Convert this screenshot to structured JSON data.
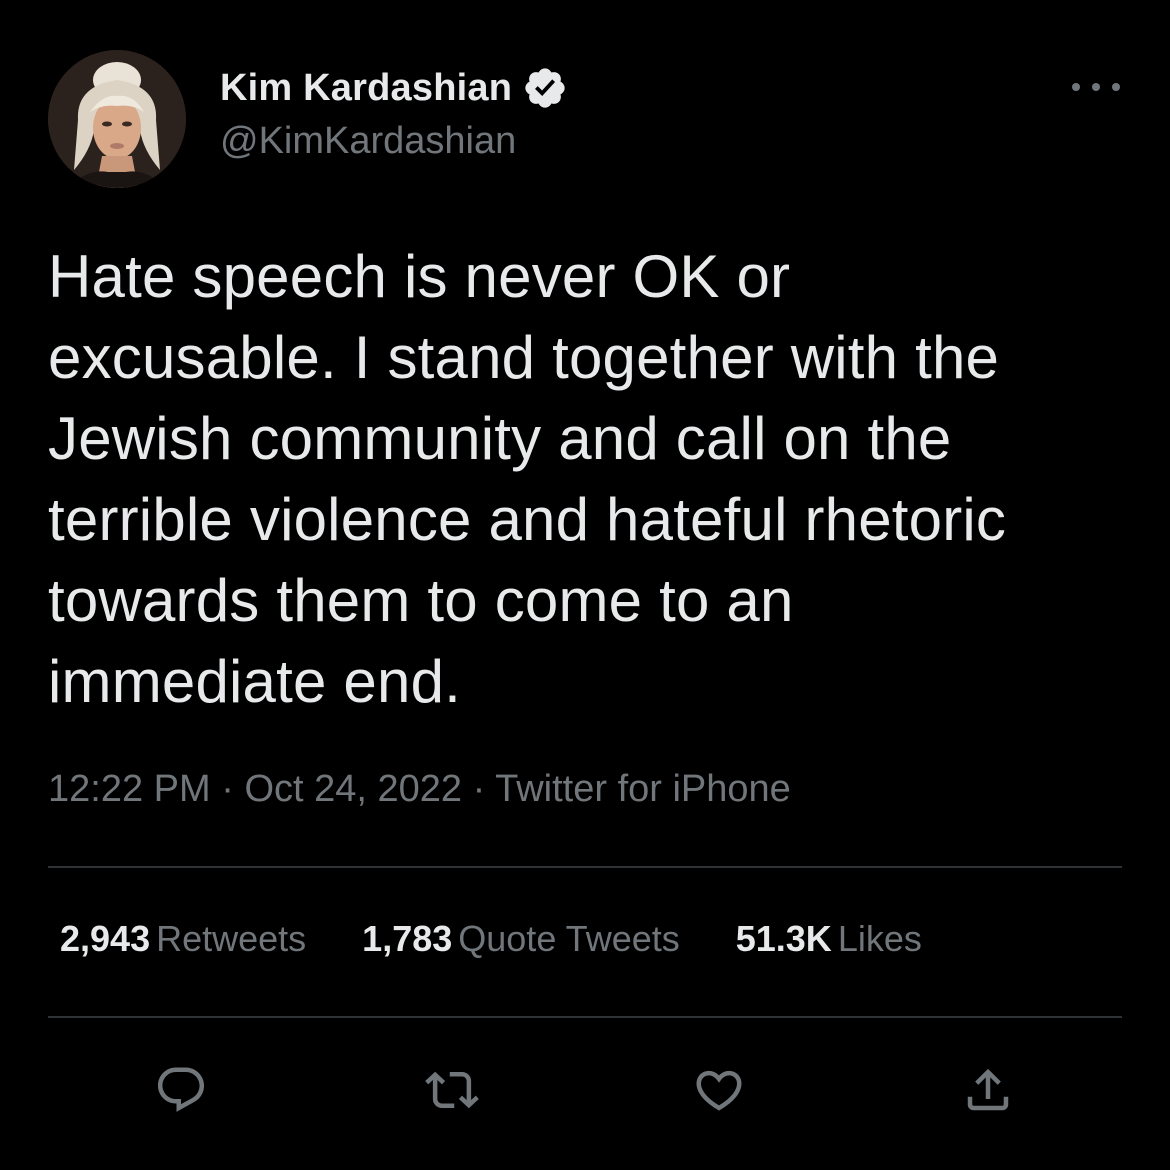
{
  "author": {
    "display_name": "Kim Kardashian",
    "handle": "@KimKardashian",
    "verified": true,
    "verified_icon": "verified-badge-icon",
    "avatar": "profile-photo"
  },
  "tweet": {
    "lines": [
      "Hate speech is never OK or",
      "excusable. I stand together with the",
      "Jewish community and call on the",
      "terrible violence and hateful rhetoric",
      "towards them to come to an",
      "immediate end."
    ]
  },
  "meta": {
    "time": "12:22 PM",
    "sep1": " · ",
    "date": "Oct 24, 2022",
    "sep2": " · ",
    "source": "Twitter for iPhone"
  },
  "stats": {
    "retweets": {
      "count": "2,943",
      "label": "Retweets"
    },
    "quotes": {
      "count": "1,783",
      "label": "Quote Tweets"
    },
    "likes": {
      "count": "51.3K",
      "label": "Likes"
    }
  },
  "actions": {
    "reply_icon": "reply-icon",
    "retweet_icon": "retweet-icon",
    "like_icon": "heart-icon",
    "share_icon": "share-icon"
  },
  "colors": {
    "background": "#000000",
    "primary_text": "#e7e9ea",
    "secondary_text": "#71767b",
    "divider": "#2f3336"
  }
}
